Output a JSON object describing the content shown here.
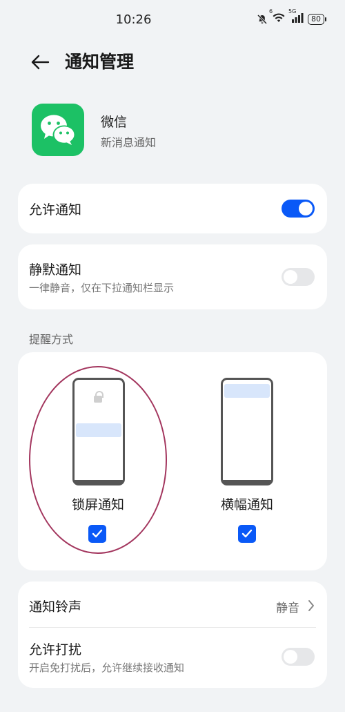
{
  "status_bar": {
    "time": "10:26",
    "signal_label": "5G",
    "sim_label": "6",
    "battery": "80"
  },
  "header": {
    "title": "通知管理"
  },
  "app": {
    "name": "微信",
    "subtitle": "新消息通知"
  },
  "allow_notifications": {
    "label": "允许通知",
    "enabled": true
  },
  "silent_notifications": {
    "label": "静默通知",
    "description": "一律静音，仅在下拉通知栏显示",
    "enabled": false
  },
  "alert_section": {
    "label": "提醒方式",
    "modes": [
      {
        "label": "锁屏通知",
        "checked": true,
        "circled": true
      },
      {
        "label": "横幅通知",
        "checked": true
      }
    ]
  },
  "ringtone": {
    "label": "通知铃声",
    "value": "静音"
  },
  "allow_disturb": {
    "label": "允许打扰",
    "description": "开启免打扰后，允许继续接收通知",
    "enabled": false
  },
  "colors": {
    "accent": "#0a59f7",
    "app_green": "#1cc165",
    "highlight": "#a3365e"
  }
}
